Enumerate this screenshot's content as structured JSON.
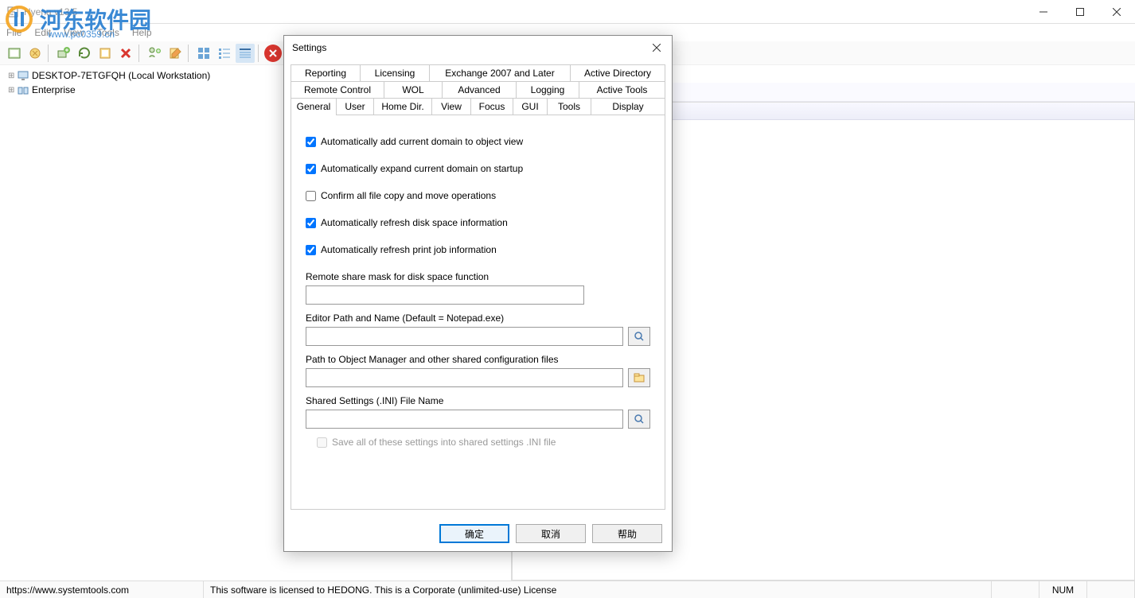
{
  "window": {
    "title": "Hyena v13.5"
  },
  "watermark": {
    "text": "河东软件园",
    "url": "www.pc0359.cn"
  },
  "menu": {
    "file": "File",
    "edit": "Edit",
    "view": "View",
    "tools": "Tools",
    "help": "Help"
  },
  "tree": {
    "items": [
      {
        "label": "DESKTOP-7ETGFQH (Local Workstation)"
      },
      {
        "label": "Enterprise"
      }
    ]
  },
  "dialog": {
    "title": "Settings",
    "tabs_row1": [
      "Reporting",
      "Licensing",
      "Exchange 2007 and Later",
      "Active Directory"
    ],
    "tabs_row2": [
      "Remote Control",
      "WOL",
      "Advanced",
      "Logging",
      "Active Tools"
    ],
    "tabs_row3": [
      "General",
      "User",
      "Home Dir.",
      "View",
      "Focus",
      "GUI",
      "Tools",
      "Display"
    ],
    "active_tab": "General",
    "checkboxes": [
      {
        "label": "Automatically add current domain to object view",
        "checked": true
      },
      {
        "label": "Automatically expand current domain on startup",
        "checked": true
      },
      {
        "label": "Confirm all file copy and move operations",
        "checked": false
      },
      {
        "label": "Automatically refresh disk space information",
        "checked": true
      },
      {
        "label": "Automatically refresh print job information",
        "checked": true
      }
    ],
    "fields": {
      "remote_mask_label": "Remote share mask for disk space function",
      "remote_mask_value": "",
      "editor_label": "Editor Path and Name (Default = Notepad.exe)",
      "editor_value": "",
      "obj_mgr_label": "Path to Object Manager and other shared configuration files",
      "obj_mgr_value": "",
      "shared_ini_label": "Shared Settings (.INI) File Name",
      "shared_ini_value": "",
      "save_shared_label": "Save all of these settings into shared settings .INI file"
    },
    "buttons": {
      "ok": "确定",
      "cancel": "取消",
      "help": "帮助"
    }
  },
  "statusbar": {
    "url": "https://www.systemtools.com",
    "license": "This software is licensed to HEDONG. This is a Corporate (unlimited-use) License",
    "num": "NUM"
  }
}
